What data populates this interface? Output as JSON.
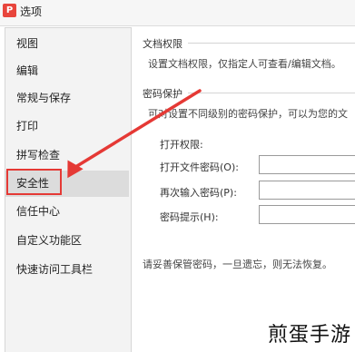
{
  "window": {
    "title": "选项",
    "app_icon_letter": "P"
  },
  "sidebar": {
    "items": [
      {
        "label": "视图"
      },
      {
        "label": "编辑"
      },
      {
        "label": "常规与保存"
      },
      {
        "label": "打印"
      },
      {
        "label": "拼写检查"
      },
      {
        "label": "安全性",
        "active": true
      },
      {
        "label": "信任中心"
      },
      {
        "label": "自定义功能区"
      },
      {
        "label": "快速访问工具栏"
      }
    ]
  },
  "doc_permission": {
    "section_title": "文档权限",
    "description": "设置文档权限，仅指定人可查看/编辑文档。"
  },
  "password_protection": {
    "section_title": "密码保护",
    "description": "可对设置不同级别的密码保护，可以为您的文",
    "open_permission_label": "打开权限:",
    "fields": [
      {
        "label": "打开文件密码(O):",
        "value": ""
      },
      {
        "label": "再次输入密码(P):",
        "value": ""
      },
      {
        "label": "密码提示(H):",
        "value": ""
      }
    ],
    "note": "请妥善保管密码，一旦遗忘，则无法恢复。"
  },
  "annotation": {
    "highlight_color": "#e53935"
  },
  "watermark": {
    "text": "煎蛋手游"
  }
}
